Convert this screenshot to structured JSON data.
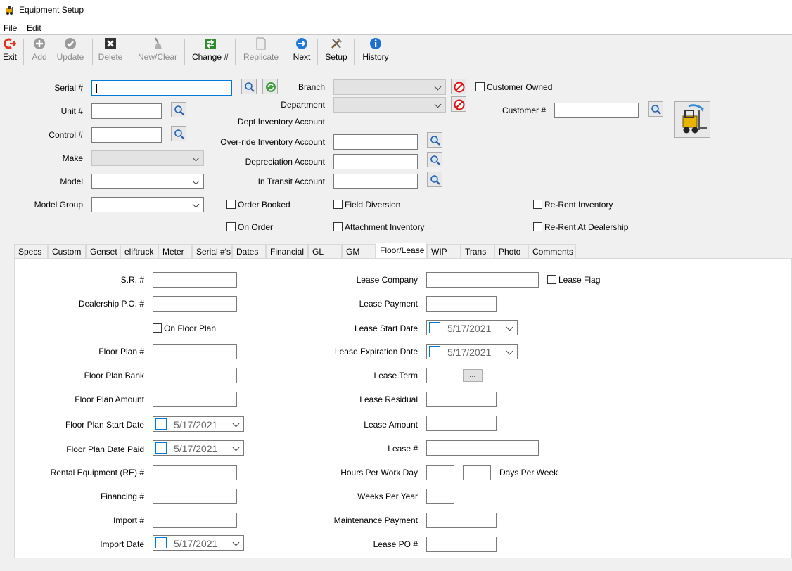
{
  "window": {
    "title": "Equipment Setup"
  },
  "menu": {
    "file": "File",
    "edit": "Edit"
  },
  "toolbar": {
    "exit": "Exit",
    "add": "Add",
    "update": "Update",
    "delete": "Delete",
    "new_clear": "New/Clear",
    "change": "Change #",
    "replicate": "Replicate",
    "next": "Next",
    "setup": "Setup",
    "history": "History"
  },
  "form": {
    "serial_label": "Serial #",
    "unit_label": "Unit #",
    "control_label": "Control #",
    "make_label": "Make",
    "model_label": "Model",
    "model_group_label": "Model Group",
    "branch_label": "Branch",
    "department_label": "Department",
    "dept_inventory_label": "Dept Inventory Account",
    "override_inventory_label": "Over-ride Inventory Account",
    "depreciation_label": "Depreciation Account",
    "in_transit_label": "In Transit Account",
    "customer_owned_label": "Customer Owned",
    "customer_label": "Customer #",
    "order_booked": "Order Booked",
    "on_order": "On Order",
    "field_diversion": "Field Diversion",
    "attachment_inventory": "Attachment Inventory",
    "rerent_inventory": "Re-Rent Inventory",
    "rerent_dealership": "Re-Rent At Dealership"
  },
  "tabs": [
    "Specs",
    "Custom",
    "Genset",
    "eliftruck",
    "Meter",
    "Serial #'s",
    "Dates",
    "Financial",
    "GL",
    "GM",
    "Floor/Lease",
    "WIP",
    "Trans",
    "Photo",
    "Comments"
  ],
  "floor_lease": {
    "sr": "S.R. #",
    "dealership_po": "Dealership P.O. #",
    "on_floor_plan": "On Floor Plan",
    "floor_plan_no": "Floor Plan #",
    "floor_plan_bank": "Floor Plan Bank",
    "floor_plan_amount": "Floor Plan Amount",
    "floor_plan_start": "Floor Plan Start Date",
    "floor_plan_start_value": "5/17/2021",
    "floor_plan_paid": "Floor Plan Date Paid",
    "floor_plan_paid_value": "5/17/2021",
    "rental_equipment": "Rental Equipment (RE) #",
    "financing": "Financing #",
    "import_no": "Import #",
    "import_date": "Import Date",
    "import_date_value": "5/17/2021",
    "lease_company": "Lease Company",
    "lease_flag": "Lease Flag",
    "lease_payment": "Lease Payment",
    "lease_start": "Lease Start Date",
    "lease_start_value": "5/17/2021",
    "lease_expiration": "Lease Expiration Date",
    "lease_expiration_value": "5/17/2021",
    "lease_term": "Lease Term",
    "ellipsis": "...",
    "lease_residual": "Lease Residual",
    "lease_amount": "Lease Amount",
    "lease_no": "Lease #",
    "hours_per_day": "Hours Per Work Day",
    "days_per_week": "Days Per Week",
    "weeks_per_year": "Weeks Per Year",
    "maintenance_payment": "Maintenance Payment",
    "lease_po": "Lease PO #"
  }
}
